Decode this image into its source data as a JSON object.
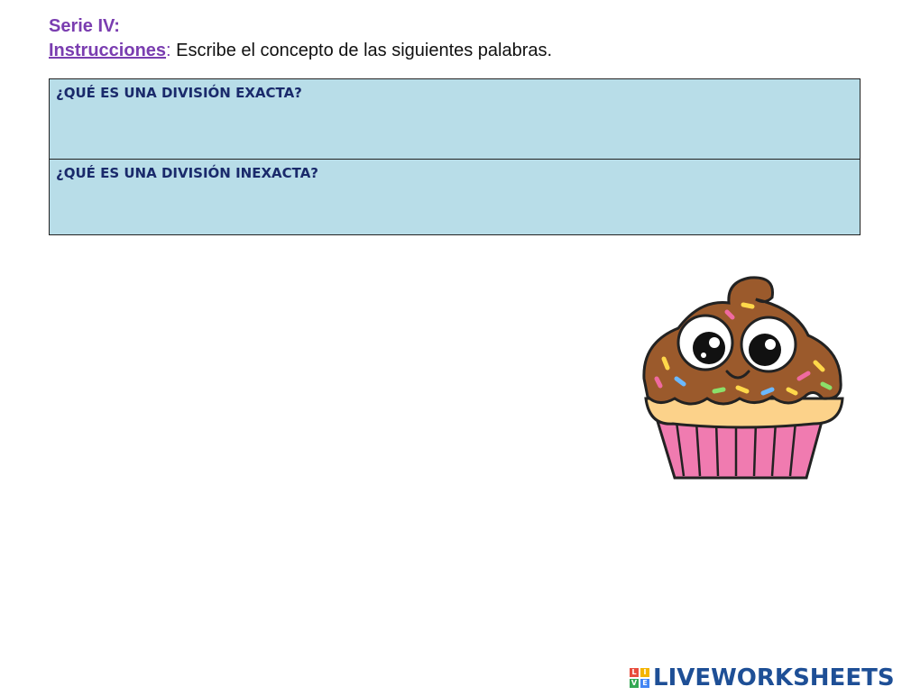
{
  "header": {
    "serie": "Serie IV:",
    "instructions_label": "Instrucciones",
    "instructions_colon": ":",
    "instructions_text": " Escribe el concepto de las siguientes palabras."
  },
  "questions": [
    {
      "label": "¿QUÉ ES UNA DIVISIÓN EXACTA?",
      "answer": ""
    },
    {
      "label": "¿QUÉ ES UNA DIVISIÓN INEXACTA?",
      "answer": ""
    }
  ],
  "illustration": {
    "icon": "cupcake-illustration"
  },
  "branding": {
    "logo_letters": [
      "L",
      "I",
      "V",
      "E"
    ],
    "logo_colors": [
      "#e84c3d",
      "#f4b400",
      "#34a853",
      "#4285f4"
    ],
    "logo_text": "LIVEWORKSHEETS"
  }
}
